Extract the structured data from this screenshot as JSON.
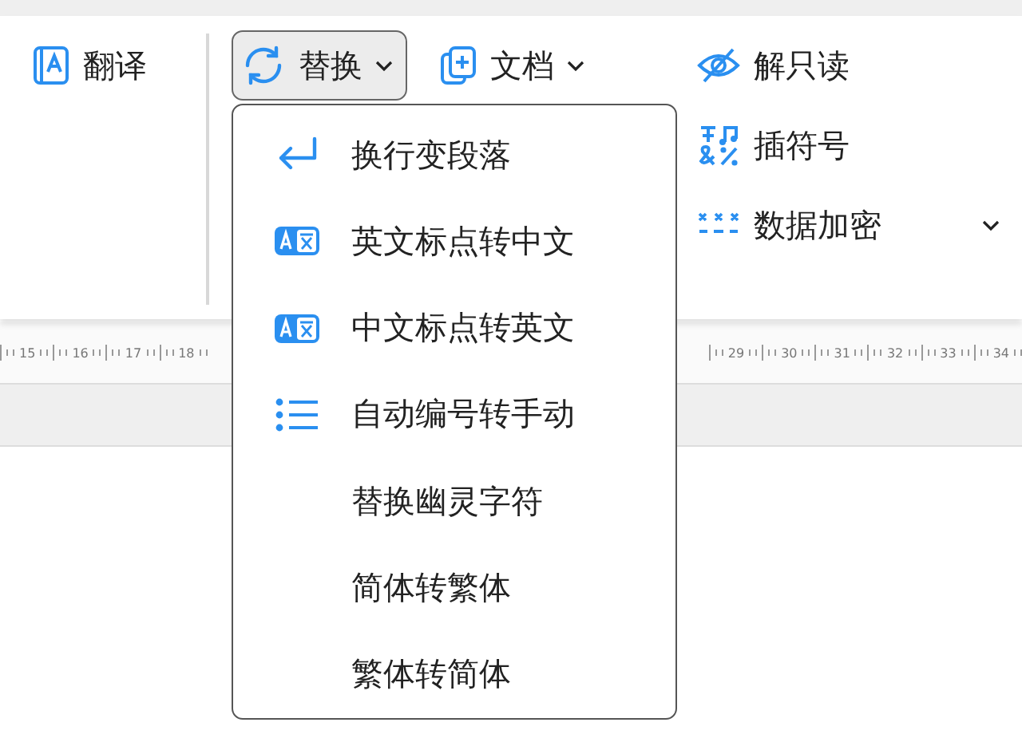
{
  "ribbon": {
    "items": [
      {
        "label": "翻译",
        "dropdown": false,
        "selected": false
      },
      {
        "label": "替换",
        "dropdown": true,
        "selected": true
      },
      {
        "label": "文档",
        "dropdown": true,
        "selected": false
      }
    ],
    "side_items": [
      {
        "label": "解只读",
        "dropdown": false
      },
      {
        "label": "插符号",
        "dropdown": false
      },
      {
        "label": "数据加密",
        "dropdown": true
      }
    ]
  },
  "ruler": {
    "left_labels": [
      "15",
      "16",
      "17",
      "18"
    ],
    "right_labels": [
      "29",
      "30",
      "31",
      "32",
      "33",
      "34"
    ]
  },
  "menu": {
    "items": [
      {
        "label": "换行变段落"
      },
      {
        "label": "英文标点转中文"
      },
      {
        "label": "中文标点转英文"
      },
      {
        "label": "自动编号转手动"
      },
      {
        "label": "替换幽灵字符"
      },
      {
        "label": "简体转繁体"
      },
      {
        "label": "繁体转简体"
      }
    ]
  }
}
